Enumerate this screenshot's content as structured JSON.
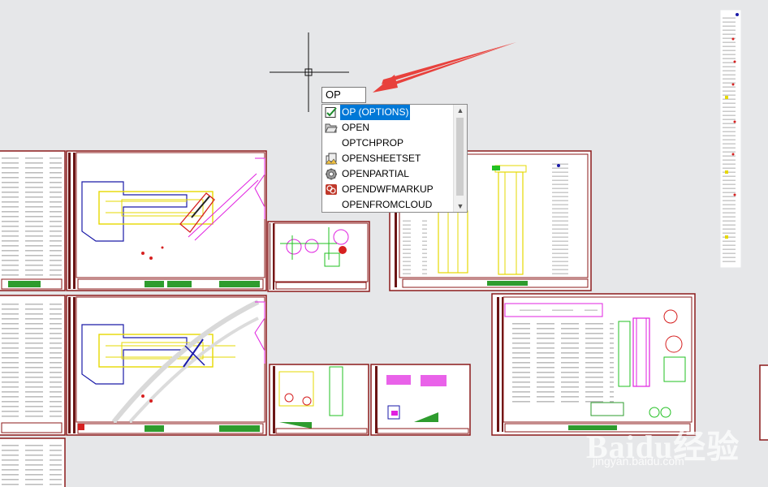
{
  "command_input": {
    "value": "OP"
  },
  "autocomplete": {
    "items": [
      {
        "label": "OP (OPTIONS)",
        "icon": "options-checkbox-icon",
        "selected": true
      },
      {
        "label": "OPEN",
        "icon": "open-folder-icon",
        "selected": false
      },
      {
        "label": "OPTCHPROP",
        "icon": "",
        "selected": false
      },
      {
        "label": "OPENSHEETSET",
        "icon": "sheetset-icon",
        "selected": false
      },
      {
        "label": "OPENPARTIAL",
        "icon": "gear-icon",
        "selected": false
      },
      {
        "label": "OPENDWFMARKUP",
        "icon": "dwf-markup-icon",
        "selected": false
      },
      {
        "label": "OPENFROMCLOUD",
        "icon": "",
        "selected": false
      }
    ]
  },
  "watermark": {
    "logo": "Baidu经验",
    "url": "jingyan.baidu.com"
  },
  "colors": {
    "canvas": "#e6e7e9",
    "frame": "#8b1a1a",
    "arrow": "#e8413c",
    "selection": "#0078d7"
  }
}
